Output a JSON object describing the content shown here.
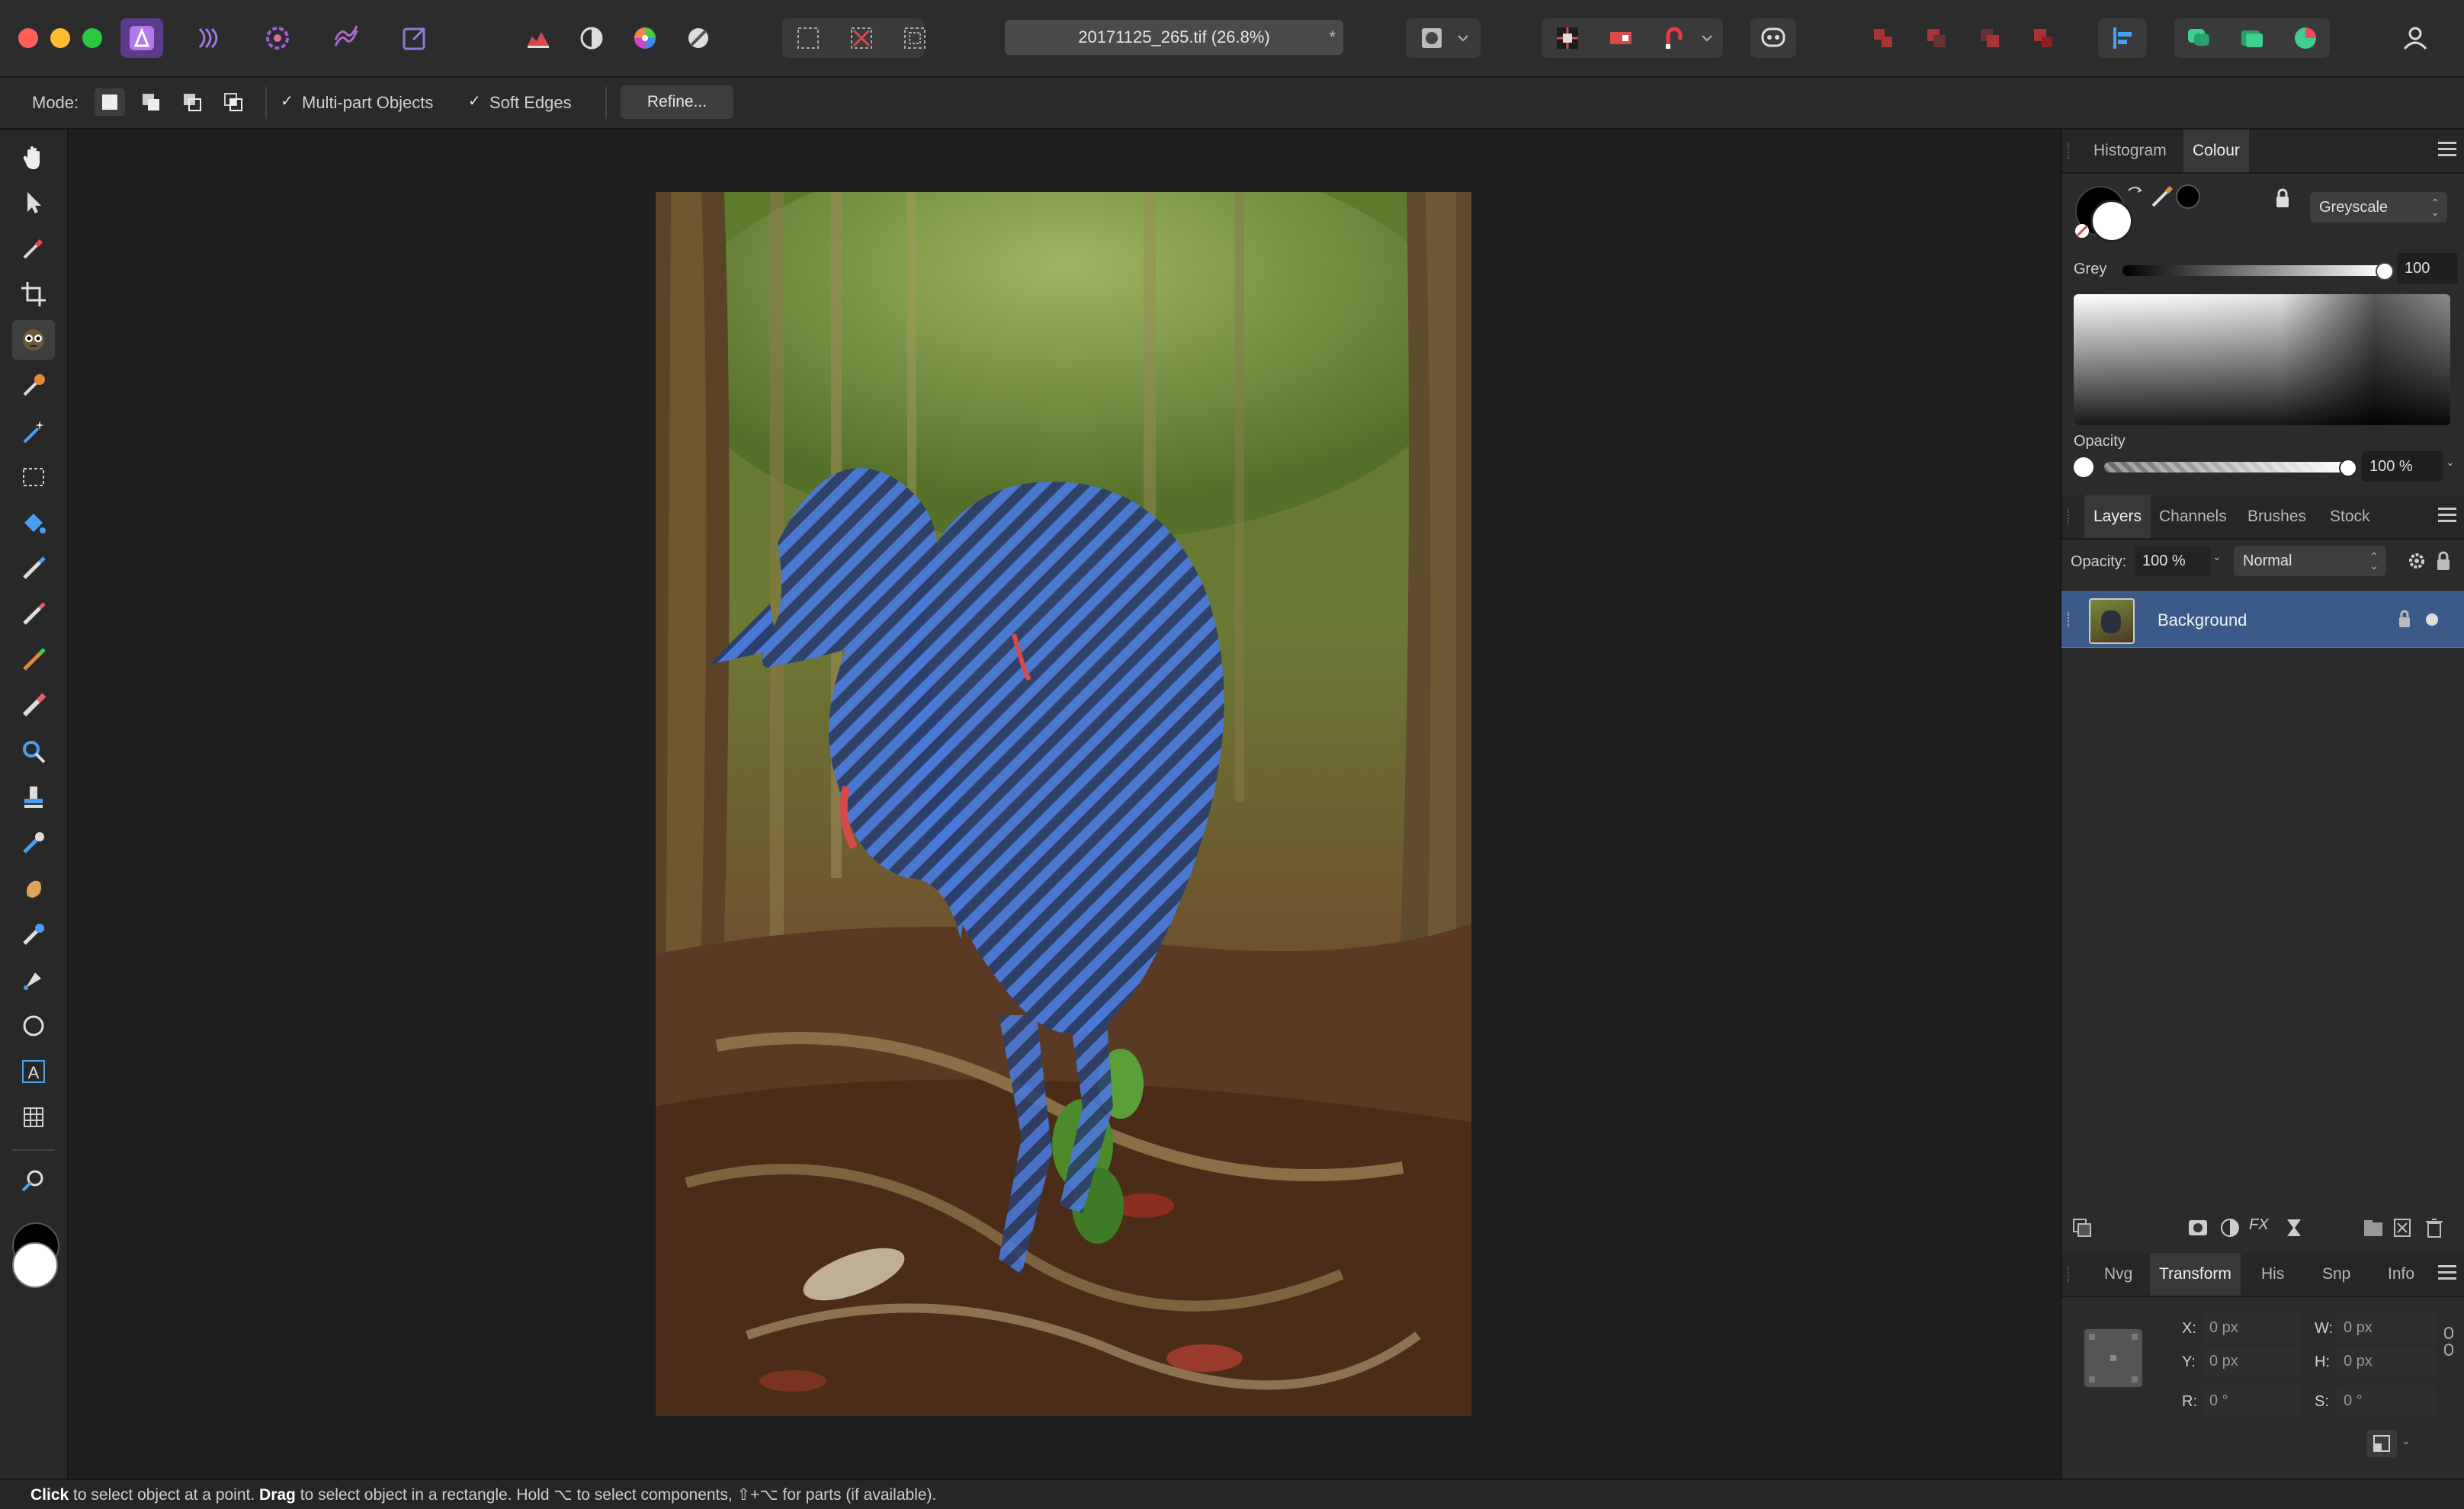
{
  "window": {
    "document_title": "20171125_265.tif (26.8%)",
    "modified_marker": "*"
  },
  "toolbar": {
    "persona_icons": [
      "photo-persona-icon",
      "liquify-persona-icon",
      "develop-persona-icon",
      "tone-mapping-persona-icon",
      "export-persona-icon"
    ],
    "tool_icons": [
      "levels-icon",
      "tone-icon",
      "colour-wheel-icon",
      "white-balance-icon",
      "marquee-icon",
      "clear-selection-icon",
      "invert-selection-icon",
      "quick-mask-icon",
      "arrange-icon",
      "snapping-icon",
      "assistant-icon",
      "boolean-icons",
      "align-icon",
      "studio-icons",
      "user-icon"
    ]
  },
  "context": {
    "mode_label": "Mode:",
    "multi_part_label": "Multi-part Objects",
    "multi_part_checked": true,
    "soft_edges_label": "Soft Edges",
    "soft_edges_checked": true,
    "refine_label": "Refine..."
  },
  "colour_panel": {
    "tabs": [
      "Histogram",
      "Colour"
    ],
    "active_tab": "Colour",
    "model": "Greyscale",
    "grey_label": "Grey",
    "grey_value": "100",
    "opacity_label": "Opacity",
    "opacity_value": "100 %"
  },
  "layers_panel": {
    "tabs": [
      "Layers",
      "Channels",
      "Brushes",
      "Stock"
    ],
    "active_tab": "Layers",
    "opacity_label": "Opacity:",
    "opacity_value": "100 %",
    "blend_mode": "Normal",
    "layers": [
      {
        "name": "Background",
        "locked": true,
        "visible": true,
        "selected": true
      }
    ]
  },
  "transform_panel": {
    "tabs": [
      "Nvg",
      "Transform",
      "His",
      "Snp",
      "Info"
    ],
    "active_tab": "Transform",
    "x_label": "X:",
    "x_value": "0 px",
    "y_label": "Y:",
    "y_value": "0 px",
    "w_label": "W:",
    "w_value": "0 px",
    "h_label": "H:",
    "h_value": "0 px",
    "r_label": "R:",
    "r_value": "0 °",
    "s_label": "S:",
    "s_value": "0 °"
  },
  "status": {
    "click_word": "Click",
    "text1": " to select object at a point. ",
    "drag_word": "Drag",
    "text2": " to select object in a rectangle. Hold ⌥ to select components, ⇧+⌥ for parts (if available)."
  },
  "colors": {
    "selection_overlay": "#3f6fd8",
    "active_layer": "#3b5a8a",
    "accent_purple": "#8e5bd8"
  }
}
